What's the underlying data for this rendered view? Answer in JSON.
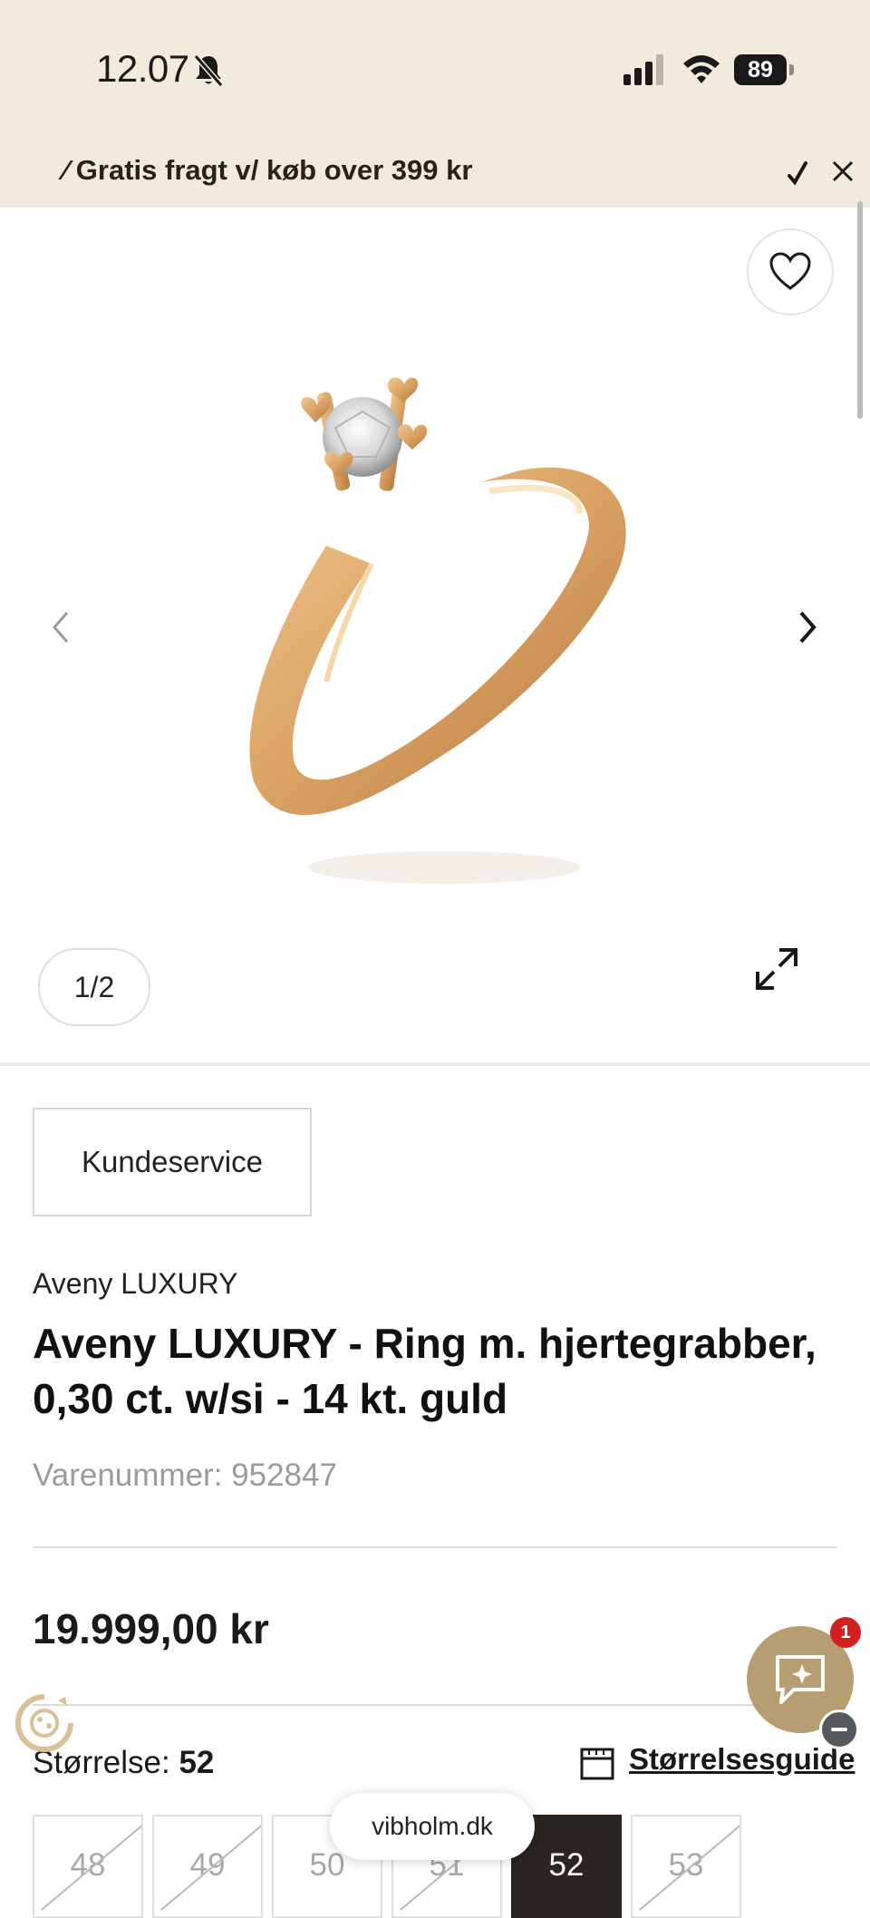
{
  "status_bar": {
    "time": "12.07",
    "battery": "89"
  },
  "promo": {
    "text": "⁄ Gratis fragt v/ køb over 399 kr"
  },
  "gallery": {
    "counter": "1/2"
  },
  "customer_service": {
    "label": "Kundeservice"
  },
  "product": {
    "brand": "Aveny LUXURY",
    "title": "Aveny LUXURY - Ring m. hjertegrabber, 0,30 ct. w/si - 14 kt. guld",
    "sku": "Varenummer: 952847",
    "price": "19.999,00 kr"
  },
  "size": {
    "label": "Størrelse:",
    "selected": "52",
    "guide_label": "Størrelsesguide",
    "options": [
      {
        "value": "48",
        "available": false
      },
      {
        "value": "49",
        "available": false
      },
      {
        "value": "50",
        "available": true
      },
      {
        "value": "51",
        "available": false
      },
      {
        "value": "52",
        "available": true,
        "selected": true
      },
      {
        "value": "53",
        "available": false
      }
    ]
  },
  "chat": {
    "badge": "1"
  },
  "browser": {
    "domain": "vibholm.dk"
  },
  "colors": {
    "header_bg": "#f1ebde",
    "chat_bg": "#b69e72",
    "selected_size_bg": "#2a2520",
    "badge": "#d32020"
  }
}
